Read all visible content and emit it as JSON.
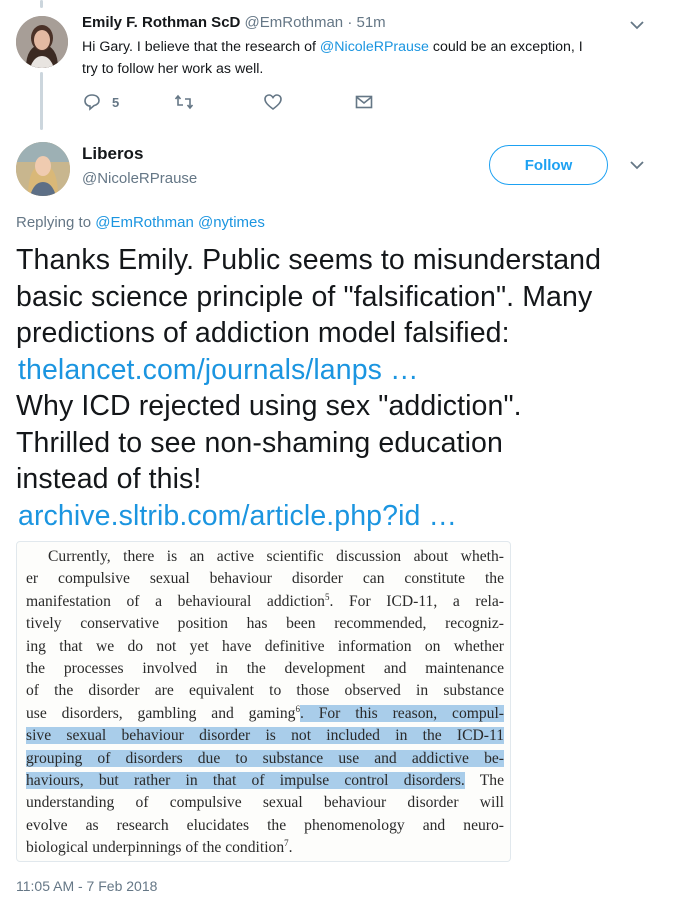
{
  "reply_tweet": {
    "author_name": "Emily F. Rothman ScD",
    "author_handle": "@EmRothman",
    "separator": "·",
    "time": "51m",
    "text_before": "Hi Gary.  I believe that the research of ",
    "mention": "@NicoleRPrause",
    "text_after_line1": "  could be an exception, I",
    "text_line2": "try to follow her work as well.",
    "reply_count": "5",
    "icons": {
      "reply": "reply-icon",
      "retweet": "retweet-icon",
      "like": "heart-icon",
      "dm": "envelope-icon",
      "menu": "chevron-down-icon"
    }
  },
  "main_tweet": {
    "author_name": "Liberos",
    "author_handle": "@NicoleRPrause",
    "follow_label": "Follow",
    "replying_prefix": "Replying to ",
    "replying_to": [
      "@EmRothman",
      "@nytimes"
    ],
    "lines": [
      "Thanks Emily. Public seems to misunderstand",
      "basic science principle of \"falsification\". Many",
      "predictions of addiction model falsified:"
    ],
    "link1": "thelancet.com/journals/lanps  …",
    "lines2": [
      "Why ICD rejected using sex \"addiction\".",
      "Thrilled to see non-shaming education",
      "instead of this!"
    ],
    "link2": "archive.sltrib.com/article.php?id …",
    "timestamp": "11:05 AM - 7 Feb 2018"
  },
  "quoted_image": {
    "lines": [
      "Currently, there is an active scientific discussion about wheth-",
      "er compulsive sexual behaviour disorder can constitute the",
      "manifestation of a behavioural addiction",
      "tively conservative position has been recommended, recogniz-",
      "ing that we do not yet have definitive information on whether",
      "the processes involved in the development and maintenance",
      "of the disorder are equivalent to those observed in substance",
      "use disorders, gambling and gaming",
      "sive sexual behaviour disorder is not included in the ICD-11",
      "grouping of disorders due to substance use and addictive be-",
      "haviours, but rather in that of impulse control disorders.",
      "understanding of compulsive sexual behaviour disorder will",
      "evolve as research elucidates the phenomenology and neuro-",
      "biological underpinnings of the condition"
    ],
    "ref5": "5",
    "line3_rest": ". For ICD-11, a rela-",
    "ref6": "6",
    "line8_highlight": ". For this reason, compul-",
    "line11_rest": " The",
    "ref7": "7",
    "end_period": "."
  },
  "colors": {
    "link": "#1b95e0",
    "follow": "#1da1f2",
    "secondary_text": "#657786",
    "highlight": "#a9cdea"
  }
}
